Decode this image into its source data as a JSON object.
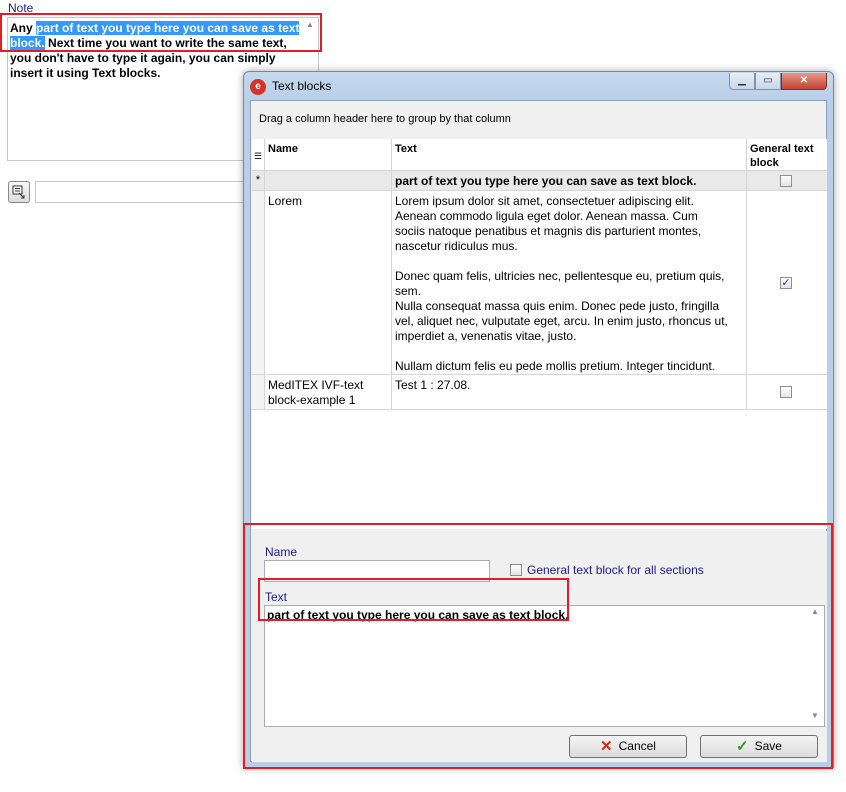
{
  "note": {
    "label": "Note",
    "text_before": "Any ",
    "text_selected": "part of text you type here you can save as text block.",
    "text_after": " Next time you want to write the same text, you don't have to type it again, you can simply insert it using Text blocks."
  },
  "dialog": {
    "title": "Text blocks",
    "group_hint": "Drag a column header here to group by that column",
    "columns": {
      "name": "Name",
      "text": "Text",
      "general": "General text block"
    },
    "new_row": {
      "indicator": "*",
      "name": "",
      "text": "part of text you type here you can save as text block.",
      "general": false
    },
    "rows": [
      {
        "name": "Lorem",
        "text_lines": [
          "Lorem ipsum dolor sit amet, consectetuer adipiscing elit.",
          "Aenean commodo ligula eget dolor. Aenean massa. Cum",
          "sociis natoque penatibus et magnis dis parturient montes,",
          "nascetur ridiculus mus.",
          "",
          "Donec quam felis, ultricies nec, pellentesque eu, pretium quis,",
          "sem.",
          "Nulla consequat massa quis enim. Donec pede justo, fringilla",
          "vel, aliquet nec, vulputate eget, arcu. In enim justo, rhoncus ut,",
          "imperdiet a, venenatis vitae, justo.",
          "",
          "Nullam dictum felis eu pede mollis pretium. Integer tincidunt."
        ],
        "general": true
      },
      {
        "name_lines": [
          "MedITEX IVF-text",
          "block-example 1"
        ],
        "text": "Test 1 : 27.08.",
        "general": false
      }
    ],
    "editor": {
      "name_label": "Name",
      "name_value": "",
      "general_label": "General text block for all sections",
      "general_checked": false,
      "text_label": "Text",
      "text_value": "part of text you type here you can save as text block."
    },
    "buttons": {
      "cancel": "Cancel",
      "save": "Save"
    }
  },
  "colors": {
    "annotation": "#e11d2a",
    "selection": "#3399ff",
    "label_blue": "#1a1a8c"
  }
}
